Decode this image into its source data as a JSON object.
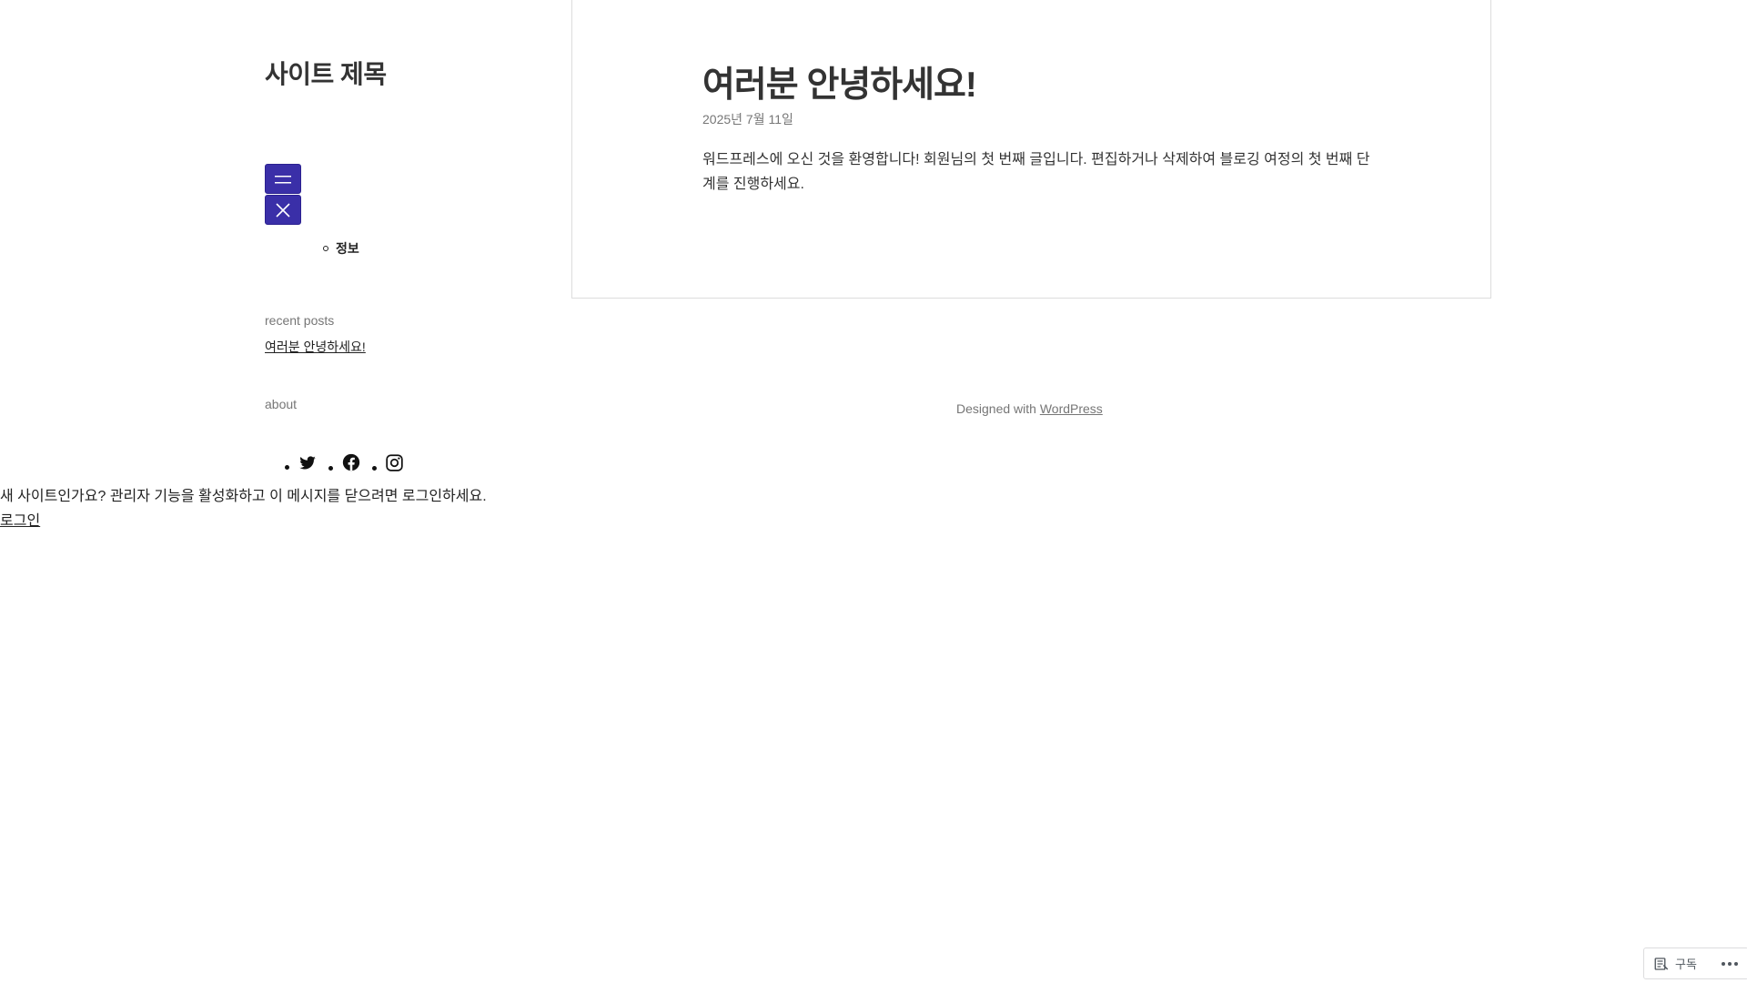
{
  "site": {
    "title": "사이트 제목"
  },
  "nav": {
    "open_icon": "menu-icon",
    "close_icon": "close-icon",
    "submenu_items": [
      "정보"
    ]
  },
  "widgets": {
    "recent_title": "recent posts",
    "recent_posts": [
      "여러분 안녕하세요!"
    ],
    "about_title": "about",
    "social_icons": [
      "twitter-icon",
      "facebook-icon",
      "instagram-icon"
    ]
  },
  "post": {
    "title": "여러분 안녕하세요!",
    "date": "2025년 7월 11일",
    "body": "워드프레스에 오신 것을 환영합니다! 회원님의 첫 번째 글입니다. 편집하거나 삭제하여 블로깅 여정의 첫 번째 단계를 진행하세요."
  },
  "footer": {
    "designed_with": "Designed with ",
    "wordpress_link": "WordPress"
  },
  "admin_notice": {
    "text": "새 사이트인가요? 관리자 기능을 활성화하고 이 메시지를 닫으려면 로그인하세요.",
    "login_link": "로그인"
  },
  "subscribe_bar": {
    "subscribe_label": "구독",
    "more_icon": "more-dots-icon"
  },
  "colors": {
    "menu_button": "#3a2fa8",
    "muted_text": "#767676",
    "card_border": "#dddddd"
  }
}
